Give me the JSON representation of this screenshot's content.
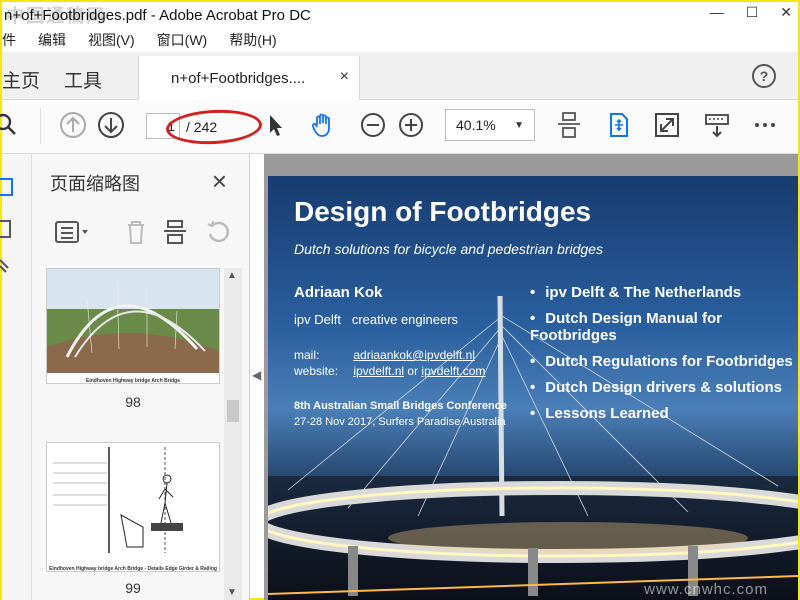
{
  "window": {
    "title": "n+of+Footbridges.pdf - Adobe Acrobat Pro DC",
    "watermark": "中国通稿网",
    "controls": [
      "—",
      "☐",
      "✕"
    ]
  },
  "menu": [
    "件",
    "编辑",
    "视图(V)",
    "窗口(W)",
    "帮助(H)"
  ],
  "tabs": {
    "home": "主页",
    "tools": "工具",
    "doc": "n+of+Footbridges....",
    "close": "×",
    "help": "?"
  },
  "toolbar": {
    "page_current": "1",
    "page_total": "/ 242",
    "zoom": "40.1%"
  },
  "sidebar": {
    "title": "页面缩略图",
    "close": "×",
    "thumbnails": [
      {
        "label": "98",
        "caption": "Eindhoven Highway bridge   Arch Bridge"
      },
      {
        "label": "99",
        "caption": "Eindhoven Highway bridge   Arch Bridge - Details Edge Girder & Railing"
      }
    ]
  },
  "slide": {
    "title": "Design of Footbridges",
    "subtitle": "Dutch solutions for bicycle and pedestrian bridges",
    "author": "Adriaan Kok",
    "company_name": "ipv Delft",
    "company_tag": "creative engineers",
    "mail_label": "mail:",
    "mail": "adriaankok@ipvdelft.nl",
    "website_label": "website:",
    "website1": "ipvdelft.nl",
    "website_or": "or",
    "website2": "ipvdelft.com",
    "conf_line1": "8th Australian Small Bridges Conference",
    "conf_line2": "27-28 Nov 2017, Surfers Paradise Australia",
    "bullets": [
      "ipv Delft & The Netherlands",
      "Dutch Design Manual for Footbridges",
      "Dutch Regulations for Footbridges",
      "Dutch Design drivers & solutions",
      "Lessons Learned"
    ],
    "watermark": "www.cnwhc.com"
  },
  "colors": {
    "accent_blue": "#1473e6",
    "annotation_red": "#d42020",
    "slide_blue": "#173c70"
  }
}
